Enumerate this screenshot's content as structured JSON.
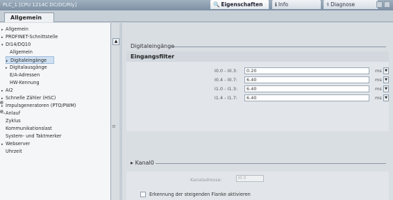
{
  "window": {
    "title": "PLC_1 [CPU 1214C DC/DC/Rly]"
  },
  "inspector_tabs": [
    {
      "label": "Eigenschaften",
      "icon": "properties-icon"
    },
    {
      "label": "Info",
      "icon": "info-icon"
    },
    {
      "label": "Diagnose",
      "icon": "diagnostics-icon"
    }
  ],
  "main_tab": {
    "label": "Allgemein"
  },
  "nav": {
    "items": [
      {
        "label": "Allgemein",
        "arrow": "▸"
      },
      {
        "label": "PROFINET-Schnittstelle",
        "arrow": "▸"
      },
      {
        "label": "DI14/DQ10",
        "arrow": "▾"
      },
      {
        "label": "Allgemein",
        "arrow": ""
      },
      {
        "label": "Digitaleingänge",
        "arrow": "▸"
      },
      {
        "label": "Digitalausgänge",
        "arrow": "▸"
      },
      {
        "label": "E/A-Adressen",
        "arrow": ""
      },
      {
        "label": "HW-Kennung",
        "arrow": ""
      },
      {
        "label": "AI2",
        "arrow": "▸"
      },
      {
        "label": "Schnelle Zähler (HSC)",
        "arrow": "▸"
      },
      {
        "label": "Impulsgeneratoren (PTO/PWM)",
        "arrow": "▸"
      },
      {
        "label": "Anlauf",
        "arrow": ""
      },
      {
        "label": "Zyklus",
        "arrow": ""
      },
      {
        "label": "Kommunikationslast",
        "arrow": ""
      },
      {
        "label": "System- und Taktmerker",
        "arrow": ""
      },
      {
        "label": "Webserver",
        "arrow": "▸"
      },
      {
        "label": "Uhrzeit",
        "arrow": ""
      }
    ]
  },
  "section": {
    "title": "Digitaleingänge"
  },
  "filter_panel": {
    "title": "Eingangsfilter",
    "rows": [
      {
        "label": "I0.0 - I0.3:",
        "value": "0.20",
        "unit": "ms"
      },
      {
        "label": "I0.4 - I0.7:",
        "value": "6.40",
        "unit": "ms"
      },
      {
        "label": "I1.0 - I1.3:",
        "value": "6.40",
        "unit": "ms"
      },
      {
        "label": "I1.4 - I1.7:",
        "value": "6.40",
        "unit": "ms"
      }
    ]
  },
  "kanal": {
    "title": "Kanal0",
    "address_label": "Kanaladresse:",
    "address_value": "I0.0",
    "checkbox_label": "Erkennung der steigenden Flanke aktivieren"
  },
  "edge_text": [
    "e",
    "e,"
  ]
}
